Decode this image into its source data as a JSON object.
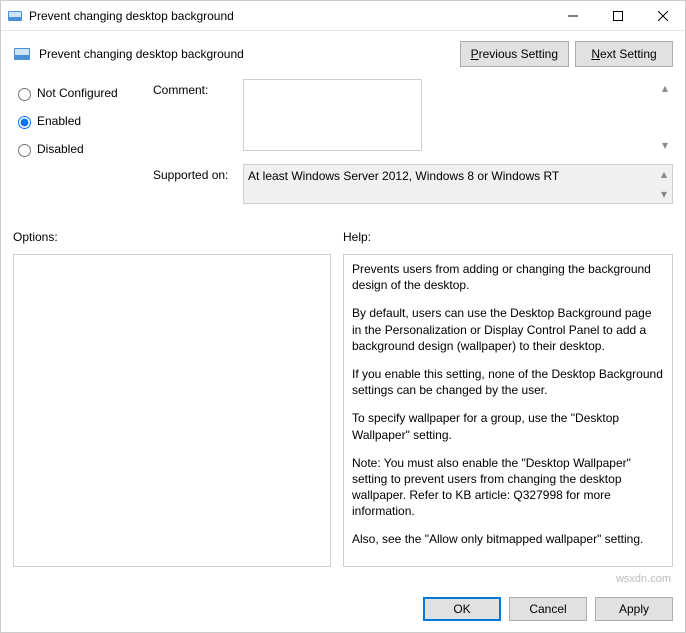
{
  "window": {
    "title": "Prevent changing desktop background"
  },
  "header": {
    "title": "Prevent changing desktop background",
    "prev": "Previous Setting",
    "next": "Next Setting"
  },
  "state": {
    "not_configured": "Not Configured",
    "enabled": "Enabled",
    "disabled": "Disabled",
    "selected": "enabled"
  },
  "form": {
    "comment_label": "Comment:",
    "comment_value": "",
    "supported_label": "Supported on:",
    "supported_value": "At least Windows Server 2012, Windows 8 or Windows RT"
  },
  "panels": {
    "options_label": "Options:",
    "help_label": "Help:",
    "help_paragraphs": [
      "Prevents users from adding or changing the background design of the desktop.",
      "By default, users can use the Desktop Background page in the Personalization or Display Control Panel to add a background design (wallpaper) to their desktop.",
      "If you enable this setting, none of the Desktop Background settings can be changed by the user.",
      "To specify wallpaper for a group, use the \"Desktop Wallpaper\" setting.",
      "Note: You must also enable the \"Desktop Wallpaper\" setting to prevent users from changing the desktop wallpaper. Refer to KB article: Q327998 for more information.",
      "Also, see the \"Allow only bitmapped wallpaper\" setting."
    ]
  },
  "footer": {
    "ok": "OK",
    "cancel": "Cancel",
    "apply": "Apply"
  },
  "watermark": "wsxdn.com"
}
